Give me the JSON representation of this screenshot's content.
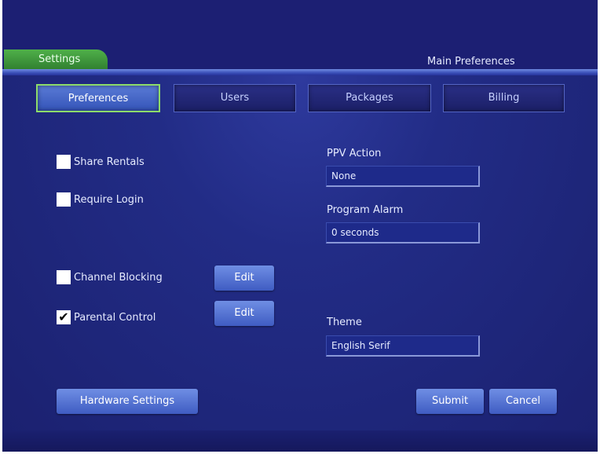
{
  "header": {
    "settings_tab": "Settings",
    "page_title": "Main Preferences"
  },
  "tabs": [
    {
      "label": "Preferences",
      "active": true
    },
    {
      "label": "Users",
      "active": false
    },
    {
      "label": "Packages",
      "active": false
    },
    {
      "label": "Billing",
      "active": false
    }
  ],
  "options": {
    "share_rentals": {
      "label": "Share Rentals",
      "checked": false
    },
    "require_login": {
      "label": "Require Login",
      "checked": false
    },
    "channel_blocking": {
      "label": "Channel Blocking",
      "checked": false,
      "edit_label": "Edit"
    },
    "parental_control": {
      "label": "Parental Control",
      "checked": true,
      "edit_label": "Edit"
    }
  },
  "fields": {
    "ppv_action": {
      "label": "PPV Action",
      "value": "None"
    },
    "program_alarm": {
      "label": "Program Alarm",
      "value": "0 seconds"
    },
    "theme": {
      "label": "Theme",
      "value": "English  Serif"
    }
  },
  "footer": {
    "hardware_settings": "Hardware Settings",
    "submit": "Submit",
    "cancel": "Cancel"
  },
  "colors": {
    "background": "#1a1d6e",
    "active_tab_border": "#8ddc6a",
    "settings_tab": "#3f9a3c",
    "button": "#4f6fd0"
  }
}
